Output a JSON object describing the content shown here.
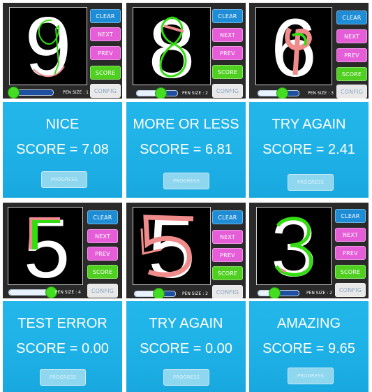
{
  "colors": {
    "clear": "#1f8dd6",
    "next": "#e55ed7",
    "prev": "#e55ed7",
    "score": "#4fcf1f",
    "config": "#e8e8e8",
    "result_bg": "#1fb3e8",
    "green_stroke": "#33dd11",
    "red_stroke": "#f08b8b"
  },
  "buttons": {
    "clear": "CLEAR",
    "next": "NEXT",
    "prev": "PREV",
    "score": "SCORE",
    "config": "CONFIG",
    "progress": "PROGRESS"
  },
  "cards": [
    {
      "digit": "9",
      "pen_size": "PEN SIZE : 1",
      "pen_level": 0.0,
      "result_title": "NICE",
      "result_score": "SCORE = 7.08"
    },
    {
      "digit": "8",
      "pen_size": "PEN SIZE : 2",
      "pen_level": 0.5,
      "result_title": "MORE OR LESS",
      "result_score": "SCORE = 6.81"
    },
    {
      "digit": "6",
      "pen_size": "PEN SIZE : 3",
      "pen_level": 0.5,
      "result_title": "TRY AGAIN",
      "result_score": "SCORE = 2.41"
    },
    {
      "digit": "5",
      "pen_size": "PEN SIZE : 4",
      "pen_level": 1.0,
      "result_title": "TEST ERROR",
      "result_score": "SCORE = 0.00"
    },
    {
      "digit": "5",
      "pen_size": "PEN SIZE : 2",
      "pen_level": 0.5,
      "result_title": "TRY AGAIN",
      "result_score": "SCORE = 0.00"
    },
    {
      "digit": "3",
      "pen_size": "PEN SIZE : 2",
      "pen_level": 0.2,
      "result_title": "AMAZING",
      "result_score": "SCORE = 9.65"
    }
  ]
}
